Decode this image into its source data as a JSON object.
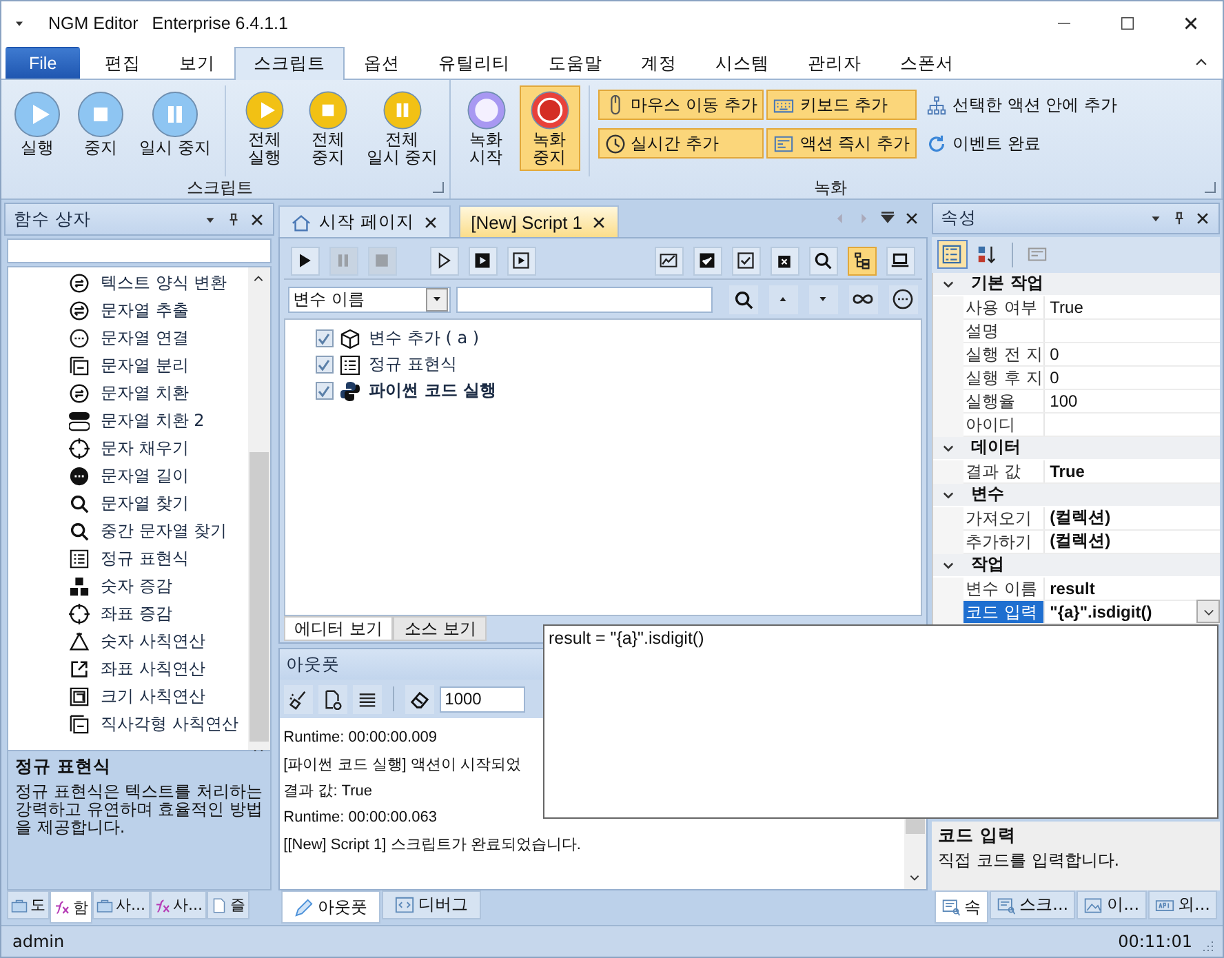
{
  "window": {
    "title": "NGM Editor",
    "edition": "Enterprise 6.4.1.1"
  },
  "menu_tabs": [
    {
      "label": "File",
      "kind": "file",
      "selected": false
    },
    {
      "label": "편집",
      "kind": "tab",
      "selected": false
    },
    {
      "label": "보기",
      "kind": "tab",
      "selected": false
    },
    {
      "label": "스크립트",
      "kind": "tab",
      "selected": true
    },
    {
      "label": "옵션",
      "kind": "tab",
      "selected": false
    },
    {
      "label": "유틸리티",
      "kind": "tab",
      "selected": false
    },
    {
      "label": "도움말",
      "kind": "tab",
      "selected": false
    },
    {
      "label": "계정",
      "kind": "tab",
      "selected": false
    },
    {
      "label": "시스템",
      "kind": "tab",
      "selected": false
    },
    {
      "label": "관리자",
      "kind": "tab",
      "selected": false
    },
    {
      "label": "스폰서",
      "kind": "tab",
      "selected": false
    }
  ],
  "ribbon": {
    "groups": [
      {
        "label": "스크립트",
        "sets": [
          [
            {
              "label": "실행",
              "kind": "play",
              "color": "#8ec5f2",
              "on": false
            },
            {
              "label": "중지",
              "kind": "stop",
              "color": "#8ec5f2",
              "on": false
            },
            {
              "label": "일시 중지",
              "kind": "pause",
              "color": "#8ec5f2",
              "on": false
            }
          ],
          [
            {
              "label": "전체\n실행",
              "kind": "play",
              "color": "#f2c114",
              "on": false
            },
            {
              "label": "전체\n중지",
              "kind": "stop",
              "color": "#f2c114",
              "on": false
            },
            {
              "label": "전체\n일시 중지",
              "kind": "pause",
              "color": "#f2c114",
              "on": false
            }
          ]
        ]
      },
      {
        "label": "녹화",
        "sets": [
          [
            {
              "label": "녹화\n시작",
              "kind": "ring",
              "color": "#a898f2",
              "on": false
            },
            {
              "label": "녹화\n중지",
              "kind": "record",
              "color": "#e8413a",
              "on": true
            }
          ]
        ],
        "small_buttons": [
          {
            "label": "마우스 이동 추가",
            "on": true
          },
          {
            "label": "키보드 추가",
            "on": true
          },
          {
            "label": "선택한 액션 안에 추가",
            "on": false
          },
          {
            "label": "실시간 추가",
            "on": true
          },
          {
            "label": "액션 즉시 추가",
            "on": true
          },
          {
            "label": "이벤트 완료",
            "on": false
          }
        ]
      }
    ]
  },
  "function_box": {
    "title": "함수 상자",
    "items": [
      "텍스트 양식 변환",
      "문자열 추출",
      "문자열 연결",
      "문자열 분리",
      "문자열 치환",
      "문자열 치환 2",
      "문자 채우기",
      "문자열 길이",
      "문자열 찾기",
      "중간 문자열 찾기",
      "정규 표현식",
      "숫자 증감",
      "좌표 증감",
      "숫자 사칙연산",
      "좌표 사칙연산",
      "크기 사칙연산",
      "직사각형 사칙연산"
    ],
    "description": {
      "title": "정규 표현식",
      "text": "정규 표현식은 텍스트를 처리하는 강력하고 유연하며 효율적인 방법을 제공합니다."
    },
    "tabs": [
      {
        "label": "도",
        "selected": false
      },
      {
        "label": "함",
        "selected": true
      },
      {
        "label": "사...",
        "selected": false
      },
      {
        "label": "사...",
        "selected": false
      },
      {
        "label": "즐",
        "selected": false
      }
    ]
  },
  "documents": {
    "tabs": [
      {
        "label": "시작 페이지",
        "selected": false
      },
      {
        "label": "[New] Script 1",
        "selected": true
      }
    ],
    "toolbar": [
      {
        "kind": "play",
        "disabled": false,
        "on": false
      },
      {
        "kind": "pause",
        "disabled": true,
        "on": false
      },
      {
        "kind": "stop",
        "disabled": true,
        "on": false
      },
      {
        "kind": "step",
        "disabled": false,
        "on": false
      },
      {
        "kind": "playbox",
        "disabled": false,
        "on": false
      },
      {
        "kind": "runbox",
        "disabled": false,
        "on": false
      },
      {
        "kind": "imgedit",
        "disabled": false,
        "on": false
      },
      {
        "kind": "check-filled",
        "disabled": false,
        "on": false
      },
      {
        "kind": "check",
        "disabled": false,
        "on": false
      },
      {
        "kind": "trash",
        "disabled": false,
        "on": false
      },
      {
        "kind": "zoom",
        "disabled": false,
        "on": false
      },
      {
        "kind": "tree",
        "disabled": false,
        "on": true
      },
      {
        "kind": "laptop",
        "disabled": false,
        "on": false
      }
    ],
    "filter": {
      "field": "변수 이름"
    },
    "tree": [
      {
        "label": "변수 추가 ( a )",
        "checked": true,
        "selected": false
      },
      {
        "label": "정규 표현식",
        "checked": true,
        "selected": false
      },
      {
        "label": "파이썬 코드 실행",
        "checked": true,
        "selected": true
      }
    ],
    "view_tabs": [
      {
        "label": "에디터 보기",
        "selected": true
      },
      {
        "label": "소스 보기",
        "selected": false
      }
    ]
  },
  "output": {
    "title": "아웃풋",
    "limit": "1000",
    "lines": [
      "Runtime: 00:00:00.009",
      "[파이썬 코드 실행] 액션이 시작되었",
      "결과 값: True",
      "Runtime: 00:00:00.063",
      "[[New] Script 1] 스크립트가 완료되었습니다."
    ],
    "tabs": [
      {
        "label": "아웃풋",
        "selected": true
      },
      {
        "label": "디버그",
        "selected": false
      }
    ]
  },
  "properties": {
    "title": "속성",
    "categories": [
      {
        "label": "기본 작업",
        "expanded": true,
        "rows": [
          {
            "name": "사용 여부",
            "value": "True",
            "modified": false,
            "selected": false
          },
          {
            "name": "설명",
            "selected": false
          },
          {
            "name": "실행 전 지",
            "value": "0",
            "modified": false,
            "selected": false
          },
          {
            "name": "실행 후 지",
            "value": "0",
            "modified": false,
            "selected": false
          },
          {
            "name": "실행율",
            "value": "100",
            "modified": false,
            "selected": false
          },
          {
            "name": "아이디",
            "selected": false
          }
        ]
      },
      {
        "label": "데이터",
        "expanded": true,
        "rows": [
          {
            "name": "결과 값",
            "value": "True",
            "modified": true,
            "selected": false
          }
        ]
      },
      {
        "label": "변수",
        "expanded": true,
        "rows": [
          {
            "name": "가져오기",
            "value": "(컬렉션)",
            "modified": true,
            "selected": false
          },
          {
            "name": "추가하기",
            "value": "(컬렉션)",
            "modified": true,
            "selected": false
          }
        ]
      },
      {
        "label": "작업",
        "expanded": true,
        "rows": [
          {
            "name": "변수 이름",
            "value": "result",
            "modified": true,
            "selected": false
          },
          {
            "name": "코드 입력",
            "value": "\"{a}\".isdigit()",
            "modified": true,
            "selected": true,
            "dropdown": true
          }
        ]
      }
    ],
    "editor_popup": {
      "text": "result = \"{a}\".isdigit()"
    },
    "description": {
      "title": "코드 입력",
      "text": "직접 코드를 입력합니다."
    },
    "tabs": [
      {
        "label": "속",
        "selected": true
      },
      {
        "label": "스크...",
        "selected": false
      },
      {
        "label": "이...",
        "selected": false
      },
      {
        "label": "외...",
        "selected": false
      }
    ]
  },
  "status_bar": {
    "user": "admin",
    "time": "00:11:01"
  }
}
